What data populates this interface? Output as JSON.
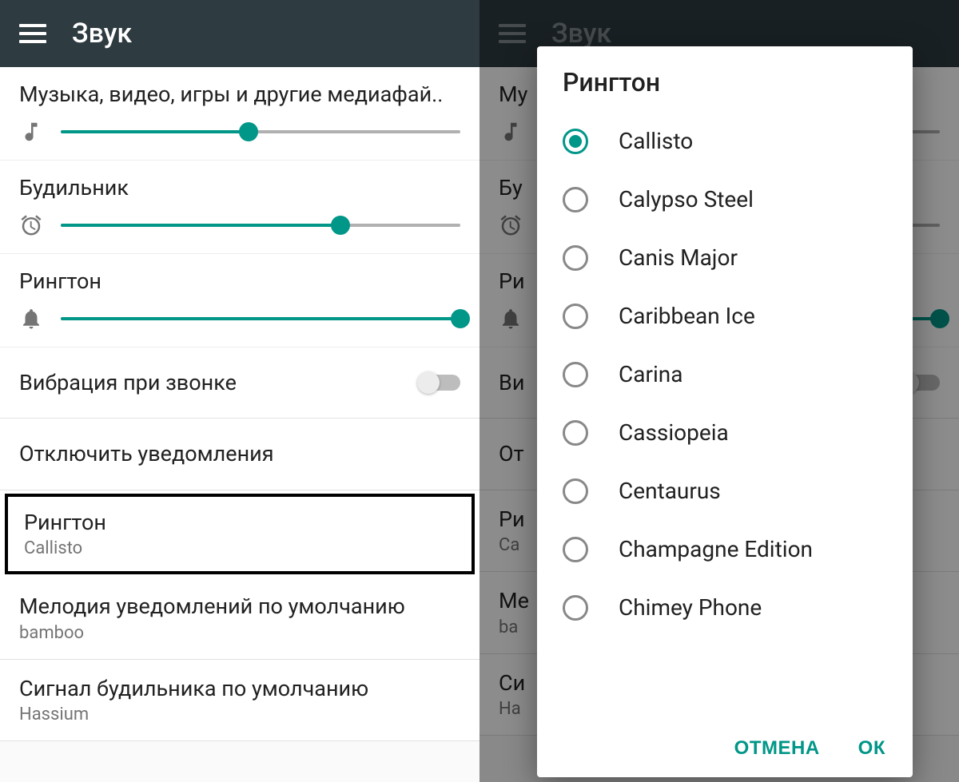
{
  "colors": {
    "accent": "#009688",
    "topbar": "#2e3b41"
  },
  "left": {
    "title": "Звук",
    "sliders": [
      {
        "label": "Музыка, видео, игры и другие медиафай..",
        "icon": "note",
        "value": 47
      },
      {
        "label": "Будильник",
        "icon": "alarm",
        "value": 70
      },
      {
        "label": "Рингтон",
        "icon": "bell",
        "value": 100
      }
    ],
    "vibrate": {
      "label": "Вибрация при звонке",
      "on": false
    },
    "mute_notifications": {
      "label": "Отключить уведомления"
    },
    "ringtone": {
      "label": "Рингтон",
      "value": "Callisto",
      "highlighted": true
    },
    "notification_sound": {
      "label": "Мелодия уведомлений по умолчанию",
      "value": "bamboo"
    },
    "alarm_sound": {
      "label": "Сигнал будильника по умолчанию",
      "value": "Hassium"
    }
  },
  "right": {
    "title": "Звук",
    "dialog": {
      "title": "Рингтон",
      "selected": "Callisto",
      "options": [
        "Callisto",
        "Calypso Steel",
        "Canis Major",
        "Caribbean Ice",
        "Carina",
        "Cassiopeia",
        "Centaurus",
        "Champagne Edition",
        "Chimey Phone"
      ],
      "cancel": "ОТМЕНА",
      "ok": "ОК"
    },
    "bg_rows": {
      "media": "Му",
      "alarm": "Бу",
      "ringtone": "Ри",
      "vibrate": "Ви",
      "mute": "От",
      "ring_row": "Ри",
      "ring_val": "Ca",
      "notif": "Ме",
      "notif_val": "ba",
      "alarm_row": "Си",
      "alarm_val": "Ha"
    }
  }
}
